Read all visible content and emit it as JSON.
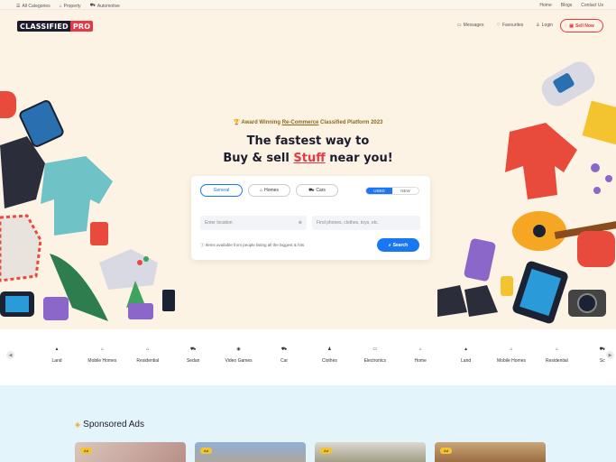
{
  "topbar": {
    "left": [
      "All Categories",
      "Property",
      "Automotive"
    ],
    "right": [
      "Home",
      "Blogs",
      "Contact Us"
    ]
  },
  "nav": {
    "logo_main": "CLASSIFIED",
    "logo_pro": "PRO",
    "links": [
      "Messages",
      "Favourites",
      "Login"
    ],
    "sell_label": "Sell Now"
  },
  "hero": {
    "award_prefix": "Award Winning",
    "award_link": "Re-Commerce",
    "award_suffix": "Classified Platform 2023",
    "headline_1": "The fastest way to",
    "headline_2_a": "Buy & sell",
    "headline_2_b": "Stuff",
    "headline_2_c": "near you!"
  },
  "search": {
    "chips": [
      "General",
      "Homes",
      "Cars"
    ],
    "toggle": [
      "USED",
      "NEW"
    ],
    "location_placeholder": "Enter location",
    "keyword_placeholder": "Find phones, clothes, toys, etc.",
    "note": "Items available from people listing all the biggest & hits",
    "button": "Search"
  },
  "categories": [
    "Land",
    "Mobile Homes",
    "Residential",
    "Sedan",
    "Video Games",
    "Car",
    "Clothes",
    "Electronics",
    "Home",
    "Land",
    "Mobile Homes",
    "Residential",
    "Sc"
  ],
  "category_icons": [
    "mountain-icon",
    "house-icon",
    "house-icon",
    "car-icon",
    "gamepad-icon",
    "car-icon",
    "shirt-icon",
    "tv-icon",
    "house-icon",
    "mountain-icon",
    "house-icon",
    "house-icon",
    "scooter-icon"
  ],
  "sponsored": {
    "title": "Sponsored Ads",
    "tags": [
      "Ad",
      "Ad",
      "Ad",
      "Ad"
    ]
  },
  "colors": {
    "brand_red": "#e63946",
    "brand_blue": "#1977f3",
    "hero_bg": "#fdf3e4",
    "sponsored_bg": "#e4f4fb"
  }
}
